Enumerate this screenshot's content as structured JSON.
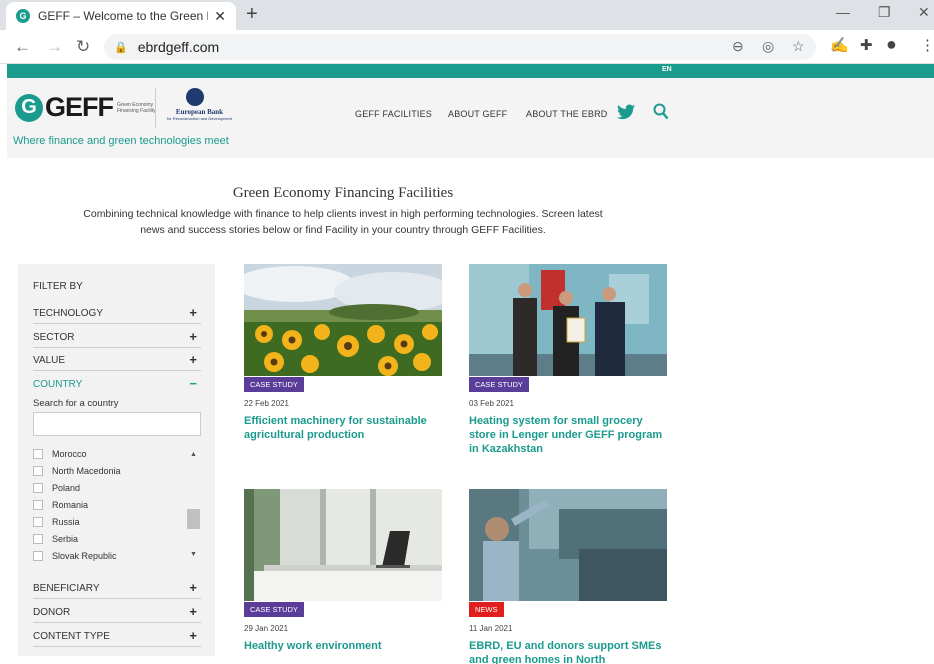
{
  "browser": {
    "tab_title": "GEFF – Welcome to the Green Ec",
    "url": "ebrdgeff.com"
  },
  "site": {
    "lang": "EN",
    "logo_word": "GEFF",
    "logo_small": "Green Economy Financing Facility",
    "ebrd_name": "European Bank",
    "ebrd_sub": "for Reconstruction and Development",
    "tagline": "Where finance and green technologies meet",
    "nav": [
      "GEFF FACILITIES",
      "ABOUT GEFF",
      "ABOUT THE EBRD"
    ],
    "colors": {
      "brand": "#1a9b8e",
      "case_study": "#5a3d99",
      "news": "#e0201f"
    }
  },
  "intro": {
    "title": "Green Economy Financing Facilities",
    "subtitle": "Combining technical knowledge with finance to help clients invest in high performing technologies. Screen latest news and success stories below or find Facility in your country through GEFF Facilities."
  },
  "filter": {
    "heading": "FILTER BY",
    "groups_top": [
      {
        "label": "TECHNOLOGY",
        "sign": "+"
      },
      {
        "label": "SECTOR",
        "sign": "+"
      },
      {
        "label": "VALUE",
        "sign": "+"
      },
      {
        "label": "COUNTRY",
        "sign": "−"
      }
    ],
    "search_label": "Search for a country",
    "countries": [
      "Morocco",
      "North Macedonia",
      "Poland",
      "Romania",
      "Russia",
      "Serbia",
      "Slovak Republic"
    ],
    "groups_bottom": [
      {
        "label": "BENEFICIARY",
        "sign": "+"
      },
      {
        "label": "DONOR",
        "sign": "+"
      },
      {
        "label": "CONTENT TYPE",
        "sign": "+"
      }
    ]
  },
  "cards": [
    {
      "badge": "CASE STUDY",
      "date": "22 Feb 2021",
      "title": "Efficient machinery for sustainable agricultural production"
    },
    {
      "badge": "CASE STUDY",
      "date": "03 Feb 2021",
      "title": "Heating system for small grocery store in Lenger under GEFF program in Kazakhstan"
    },
    {
      "badge": "CASE STUDY",
      "date": "29 Jan 2021",
      "title": "Healthy work environment"
    },
    {
      "badge": "NEWS",
      "date": "11 Jan 2021",
      "title": "EBRD, EU and donors support SMEs and green homes in North"
    }
  ]
}
